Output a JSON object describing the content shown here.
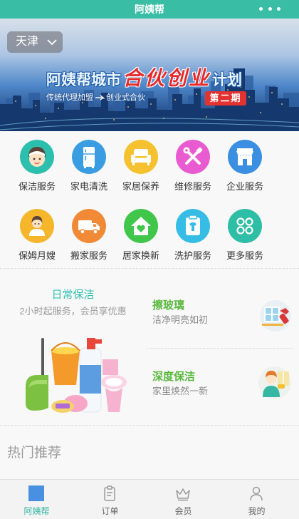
{
  "header": {
    "title": "阿姨帮",
    "more_icon": "more-dots-icon"
  },
  "banner": {
    "city": "天津",
    "city_dropdown_icon": "chevron-down-icon",
    "title_prefix": "阿姨帮城市",
    "title_highlight": "合伙创业",
    "title_suffix": "计划",
    "subtitle_from": "传统代理加盟",
    "subtitle_arrow_icon": "arrow-right-icon",
    "subtitle_to": "创业式合伙",
    "badge": "第二期"
  },
  "services": [
    {
      "label": "保洁服务",
      "icon": "cleaning-lady-icon",
      "color": "#2dbfae"
    },
    {
      "label": "家电清洗",
      "icon": "refrigerator-icon",
      "color": "#3a9de1"
    },
    {
      "label": "家居保养",
      "icon": "sofa-icon",
      "color": "#f5c12e"
    },
    {
      "label": "维修服务",
      "icon": "tools-icon",
      "color": "#e95bd1"
    },
    {
      "label": "企业服务",
      "icon": "storefront-icon",
      "color": "#3b8fe0"
    },
    {
      "label": "保姆月嫂",
      "icon": "nanny-icon",
      "color": "#f5b62c"
    },
    {
      "label": "搬家服务",
      "icon": "moving-truck-icon",
      "color": "#f08a37"
    },
    {
      "label": "居家换新",
      "icon": "house-heart-icon",
      "color": "#3fc64b"
    },
    {
      "label": "洗护服务",
      "icon": "laundry-icon",
      "color": "#37bde5"
    },
    {
      "label": "更多服务",
      "icon": "more-grid-icon",
      "color": "#2ebda5"
    }
  ],
  "promo": {
    "featured": {
      "title": "日常保洁",
      "subtitle": "2小时起服务，会员享优惠",
      "illustration": "cleaning-supplies-illustration"
    },
    "side_items": [
      {
        "title": "擦玻璃",
        "subtitle": "洁净明亮如初",
        "icon": "window-cleaning-icon"
      },
      {
        "title": "深度保洁",
        "subtitle": "家里焕然一新",
        "icon": "deep-cleaning-icon"
      }
    ]
  },
  "hot_section": {
    "title": "热门推荐"
  },
  "tabbar": {
    "tabs": [
      {
        "label": "阿姨帮",
        "icon": "home-square-icon",
        "active": true
      },
      {
        "label": "订单",
        "icon": "order-clipboard-icon",
        "active": false
      },
      {
        "label": "会员",
        "icon": "crown-icon",
        "active": false
      },
      {
        "label": "我的",
        "icon": "user-icon",
        "active": false
      }
    ]
  },
  "colors": {
    "primary": "#39bda5",
    "featured_title": "#2dbfae",
    "side_title": "#58b83c",
    "tab_active": "#31b5a0",
    "badge": "#e3322f",
    "title_highlight": "#e52b2b"
  }
}
